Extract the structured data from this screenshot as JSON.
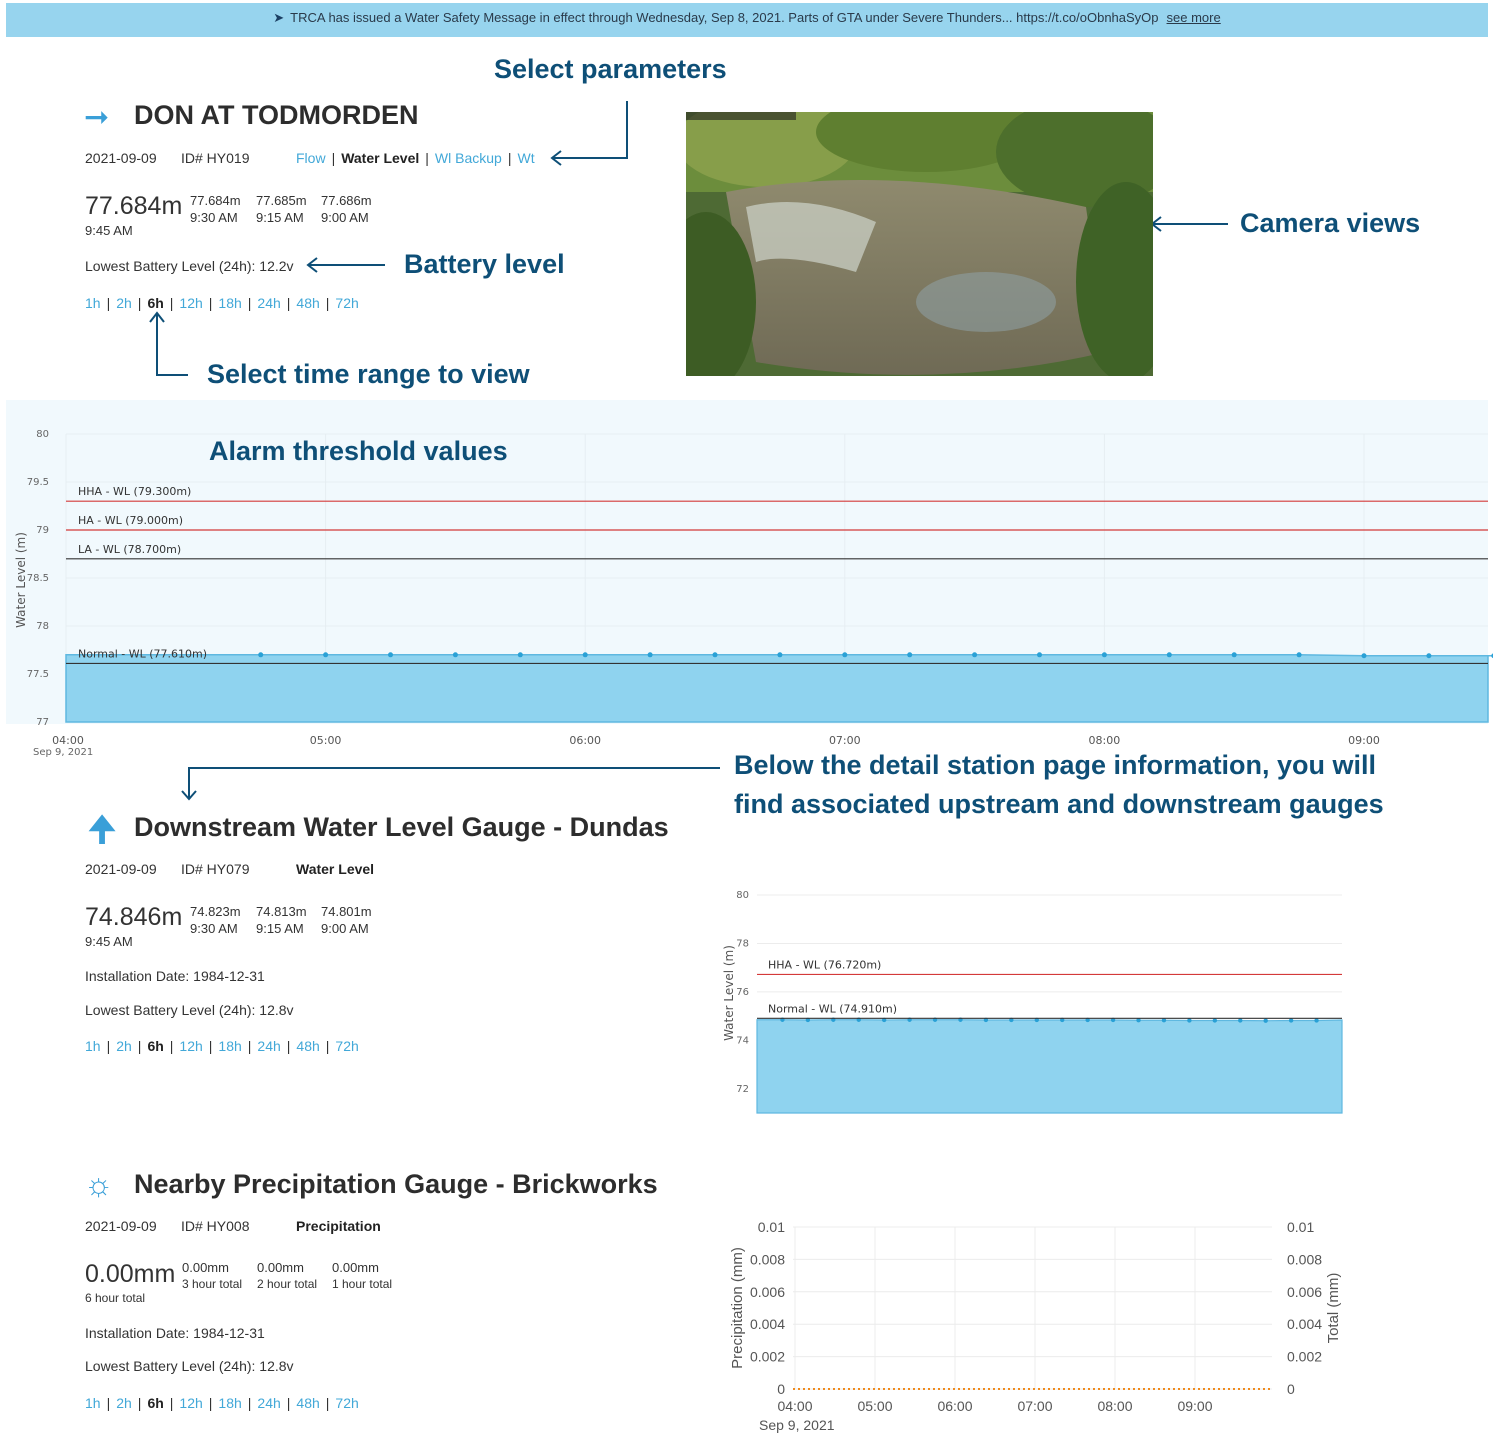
{
  "banner": {
    "text": "TRCA has issued a Water Safety Message in effect through Wednesday, Sep 8, 2021. Parts of GTA under Severe Thunders... https://t.co/oObnhaSyOp",
    "link": "see more"
  },
  "callouts": {
    "select_parameters": "Select parameters",
    "camera_views": "Camera views",
    "battery_level": "Battery level",
    "time_range": "Select time range to view",
    "alarm_thresholds": "Alarm threshold values",
    "below_detail_1": "Below the detail station page information, you will",
    "below_detail_2": "find associated upstream and downstream gauges"
  },
  "main_station": {
    "name": "DON AT TODMORDEN",
    "date": "2021-09-09",
    "id": "ID# HY019",
    "params": [
      {
        "label": "Flow",
        "active": false
      },
      {
        "label": "Water Level",
        "active": true
      },
      {
        "label": "Wl Backup",
        "active": false
      },
      {
        "label": "Wt",
        "active": false
      }
    ],
    "current_value": "77.684m",
    "current_time": "9:45 AM",
    "history": [
      {
        "value": "77.684m",
        "time": "9:30 AM"
      },
      {
        "value": "77.685m",
        "time": "9:15 AM"
      },
      {
        "value": "77.686m",
        "time": "9:00 AM"
      }
    ],
    "battery": "Lowest Battery Level (24h): 12.2v",
    "ranges": [
      "1h",
      "2h",
      "6h",
      "12h",
      "18h",
      "24h",
      "48h",
      "72h"
    ],
    "active_range": "6h"
  },
  "downstream": {
    "name": "Downstream Water Level Gauge - Dundas",
    "date": "2021-09-09",
    "id": "ID# HY079",
    "param": "Water Level",
    "current_value": "74.846m",
    "current_time": "9:45 AM",
    "history": [
      {
        "value": "74.823m",
        "time": "9:30 AM"
      },
      {
        "value": "74.813m",
        "time": "9:15 AM"
      },
      {
        "value": "74.801m",
        "time": "9:00 AM"
      }
    ],
    "installation": "Installation Date: 1984-12-31",
    "battery": "Lowest Battery Level (24h): 12.8v",
    "ranges": [
      "1h",
      "2h",
      "6h",
      "12h",
      "18h",
      "24h",
      "48h",
      "72h"
    ],
    "active_range": "6h"
  },
  "precip": {
    "name": "Nearby Precipitation Gauge - Brickworks",
    "date": "2021-09-09",
    "id": "ID# HY008",
    "param": "Precipitation",
    "current_value": "0.00mm",
    "current_time": "6 hour total",
    "history": [
      {
        "value": "0.00mm",
        "time": "3 hour total"
      },
      {
        "value": "0.00mm",
        "time": "2 hour total"
      },
      {
        "value": "0.00mm",
        "time": "1 hour total"
      }
    ],
    "installation": "Installation Date: 1984-12-31",
    "battery": "Lowest Battery Level (24h): 12.8v",
    "ranges": [
      "1h",
      "2h",
      "6h",
      "12h",
      "18h",
      "24h",
      "48h",
      "72h"
    ],
    "active_range": "6h"
  },
  "colors": {
    "banner": "#97d4ee",
    "callout": "#0e4f77",
    "link": "#42a8d8",
    "fill": "#8fd3ef",
    "alarm_high": "#d43a3a",
    "alarm_low": "#333333"
  },
  "chart_data": [
    {
      "type": "area",
      "ylabel": "Water Level (m)",
      "ylim": [
        77,
        80
      ],
      "yticks": [
        "80",
        "79.5",
        "79",
        "78.5",
        "78",
        "77.5",
        "77"
      ],
      "xticks": [
        "04:00",
        "05:00",
        "06:00",
        "07:00",
        "08:00",
        "09:00"
      ],
      "xsub": "Sep 9, 2021",
      "thresholds": [
        {
          "label": "HHA - WL (79.300m)",
          "value": 79.3,
          "color": "#d43a3a"
        },
        {
          "label": "HA - WL (79.000m)",
          "value": 79.0,
          "color": "#d43a3a"
        },
        {
          "label": "LA - WL (78.700m)",
          "value": 78.7,
          "color": "#333333"
        },
        {
          "label": "Normal - WL (77.610m)",
          "value": 77.61,
          "color": "#333333"
        }
      ],
      "series": [
        {
          "values": [
            77.7,
            77.7,
            77.7,
            77.7,
            77.7,
            77.7,
            77.7,
            77.7,
            77.7,
            77.7,
            77.7,
            77.7,
            77.7,
            77.7,
            77.7,
            77.7,
            77.7,
            77.7,
            77.7,
            77.7,
            77.69,
            77.69,
            77.69
          ]
        }
      ]
    },
    {
      "type": "area",
      "ylabel": "Water Level (m)",
      "ylim": [
        71,
        80
      ],
      "yticks": [
        "80",
        "78",
        "76",
        "74",
        "72"
      ],
      "thresholds": [
        {
          "label": "HHA - WL (76.720m)",
          "value": 76.72,
          "color": "#d43a3a"
        },
        {
          "label": "Normal - WL (74.910m)",
          "value": 74.91,
          "color": "#333333"
        }
      ],
      "series": [
        {
          "values": [
            74.85,
            74.85,
            74.84,
            74.85,
            74.85,
            74.84,
            74.85,
            74.85,
            74.85,
            74.84,
            74.84,
            74.84,
            74.84,
            74.84,
            74.84,
            74.83,
            74.83,
            74.82,
            74.82,
            74.82,
            74.81,
            74.82,
            74.82,
            74.84
          ]
        }
      ]
    },
    {
      "type": "bar",
      "ylabel": "Precipitation (mm)",
      "y2label": "Total (mm)",
      "ylim": [
        0,
        0.01
      ],
      "yticks": [
        "0.01",
        "0.008",
        "0.006",
        "0.004",
        "0.002",
        "0"
      ],
      "xticks": [
        "04:00",
        "05:00",
        "06:00",
        "07:00",
        "08:00",
        "09:00"
      ],
      "xsub": "Sep 9, 2021",
      "series": [
        {
          "values": [
            0,
            0,
            0,
            0,
            0,
            0
          ]
        }
      ]
    }
  ]
}
